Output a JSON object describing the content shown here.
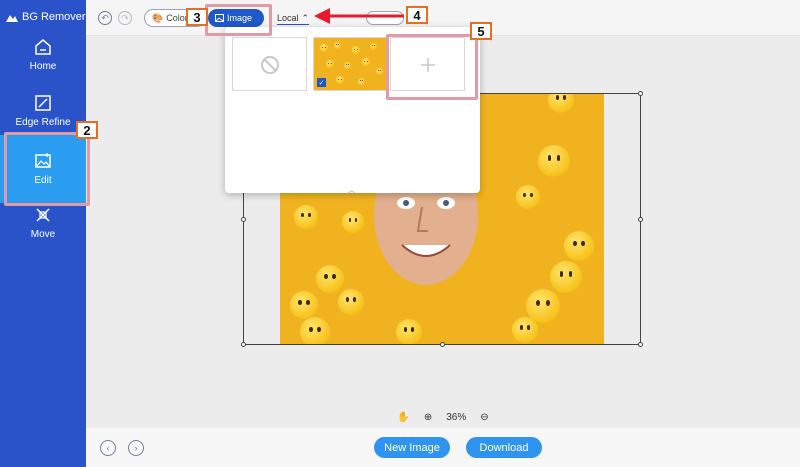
{
  "app": {
    "title": "BG Remover"
  },
  "sidebar": {
    "items": [
      {
        "label": "Home",
        "icon": "home-icon"
      },
      {
        "label": "Edge Refine",
        "icon": "edge-refine-icon"
      },
      {
        "label": "Edit",
        "icon": "edit-image-icon",
        "active": true
      },
      {
        "label": "Move",
        "icon": "move-icon"
      }
    ]
  },
  "toolbar": {
    "color_label": "Color",
    "image_label": "Image",
    "local_label": "Local"
  },
  "dropdown": {
    "options": [
      {
        "name": "none",
        "icon": "no-background-icon"
      },
      {
        "name": "preset-image",
        "checked": true
      },
      {
        "name": "add-local-image",
        "icon": "plus-icon"
      }
    ]
  },
  "zoom": {
    "level": "36%"
  },
  "buttons": {
    "new_image": "New Image",
    "download": "Download"
  },
  "annotations": {
    "step2": "2",
    "step3": "3",
    "step4": "4",
    "step5": "5"
  },
  "colors": {
    "sidebar": "#2a53c9",
    "active": "#2a9df0",
    "accent": "#2f93f0",
    "callout_border": "#e36f23",
    "highlight": "#e29aa6"
  }
}
